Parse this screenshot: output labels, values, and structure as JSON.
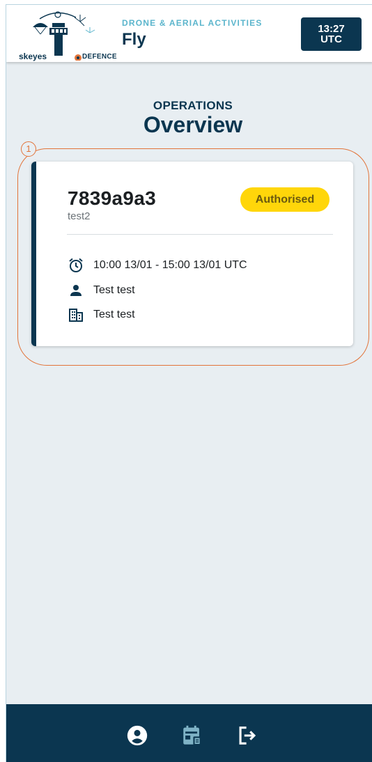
{
  "header": {
    "brand_skeyes": "skeyes",
    "brand_defence": "DEFENCE",
    "subtitle": "DRONE & AERIAL ACTIVITIES",
    "title": "Fly",
    "clock_time": "13:27",
    "clock_zone": "UTC"
  },
  "page": {
    "subtitle": "OPERATIONS",
    "title": "Overview"
  },
  "annotation": {
    "number": "1"
  },
  "operation": {
    "id": "7839a9a3",
    "name": "test2",
    "status": "Authorised",
    "time_window": "10:00 13/01 - 15:00 13/01 UTC",
    "pilot": "Test test",
    "organisation": "Test test"
  },
  "bottom_nav": {
    "items": [
      {
        "icon": "account-circle-icon"
      },
      {
        "icon": "calendar-list-icon"
      },
      {
        "icon": "logout-icon"
      }
    ]
  },
  "colors": {
    "primary": "#0b3650",
    "accent": "#5bb5cc",
    "status_authorised": "#ffd60a",
    "annotation": "#e2743a",
    "background": "#e8eef2"
  }
}
